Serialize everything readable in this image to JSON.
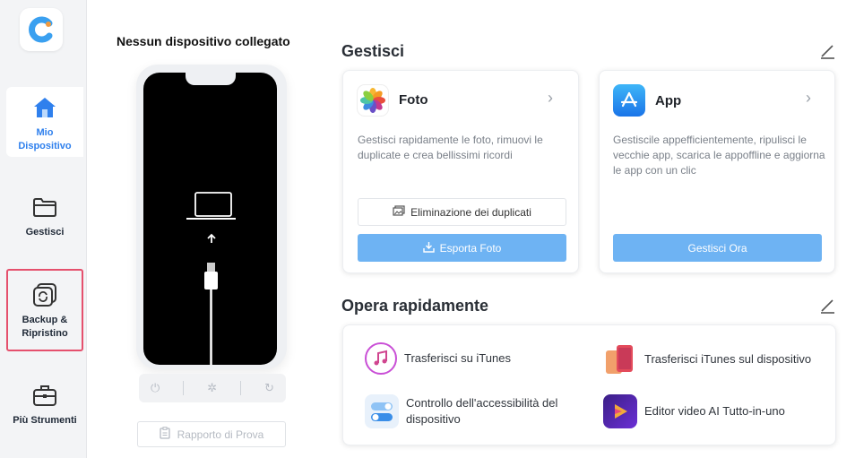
{
  "sidebar": {
    "items": [
      {
        "label": "Mio Dispositivo",
        "icon": "home-icon",
        "active": true
      },
      {
        "label": "Gestisci",
        "icon": "folder-icon"
      },
      {
        "label": "Backup & Ripristino",
        "icon": "backup-restore-icon"
      },
      {
        "label": "Più Strumenti",
        "icon": "toolbox-icon"
      }
    ]
  },
  "device": {
    "title": "Nessun dispositivo collegato",
    "report_button": "Rapporto di Prova"
  },
  "manage": {
    "title": "Gestisci",
    "photo_card": {
      "title": "Foto",
      "description": "Gestisci rapidamente le foto, rimuovi le duplicate e crea bellissimi ricordi",
      "secondary_button": "Eliminazione dei duplicati",
      "primary_button": "Esporta Foto"
    },
    "app_card": {
      "title": "App",
      "description": "Gestiscile appefficientemente, ripulisci le vecchie app, scarica le appoffline e aggiorna le app con un clic",
      "primary_button": "Gestisci Ora"
    }
  },
  "quick": {
    "title": "Opera rapidamente",
    "items": [
      {
        "label": "Trasferisci su iTunes",
        "icon": "itunes-icon"
      },
      {
        "label": "Trasferisci iTunes sul dispositivo",
        "icon": "device-transfer-icon"
      },
      {
        "label": "Controllo dell'accessibilità del dispositivo",
        "icon": "accessibility-toggle-icon"
      },
      {
        "label": "Editor video AI Tutto-in-uno",
        "icon": "video-editor-icon"
      }
    ]
  },
  "colors": {
    "accent": "#2f80ed",
    "primary_button": "#6eb3f3",
    "highlight_border": "#e5506d"
  }
}
